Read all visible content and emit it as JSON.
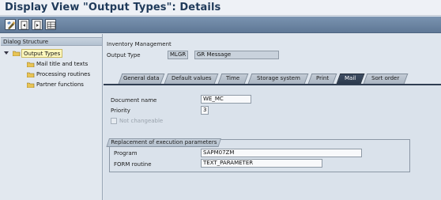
{
  "window": {
    "title": "Display View \"Output Types\": Details"
  },
  "toolbar": {
    "buttons": [
      {
        "icon": "display-change-icon"
      },
      {
        "icon": "previous-entry-icon"
      },
      {
        "icon": "next-entry-icon"
      },
      {
        "icon": "table-view-icon"
      }
    ]
  },
  "dialog_structure": {
    "heading": "Dialog Structure",
    "items": [
      {
        "label": "Output Types",
        "selected": true
      },
      {
        "label": "Mail title and texts"
      },
      {
        "label": "Processing routines"
      },
      {
        "label": "Partner functions"
      }
    ]
  },
  "header": {
    "application": "Inventory Management",
    "output_type_label": "Output Type",
    "output_type_value": "MLGR",
    "output_type_description": "GR Message"
  },
  "tabs": [
    {
      "label": "General data"
    },
    {
      "label": "Default values"
    },
    {
      "label": "Time"
    },
    {
      "label": "Storage system"
    },
    {
      "label": "Print"
    },
    {
      "label": "Mail",
      "active": true
    },
    {
      "label": "Sort order"
    }
  ],
  "mail": {
    "document_name_label": "Document name",
    "document_name_value": "WE_MC",
    "priority_label": "Priority",
    "priority_value": "3",
    "not_changeable_label": "Not changeable",
    "not_changeable_checked": false
  },
  "replacement": {
    "title": "Replacement of execution parameters",
    "program_label": "Program",
    "program_value": "SAPM07ZM",
    "form_label": "FORM routine",
    "form_value": "TEXT_PARAMETER"
  }
}
